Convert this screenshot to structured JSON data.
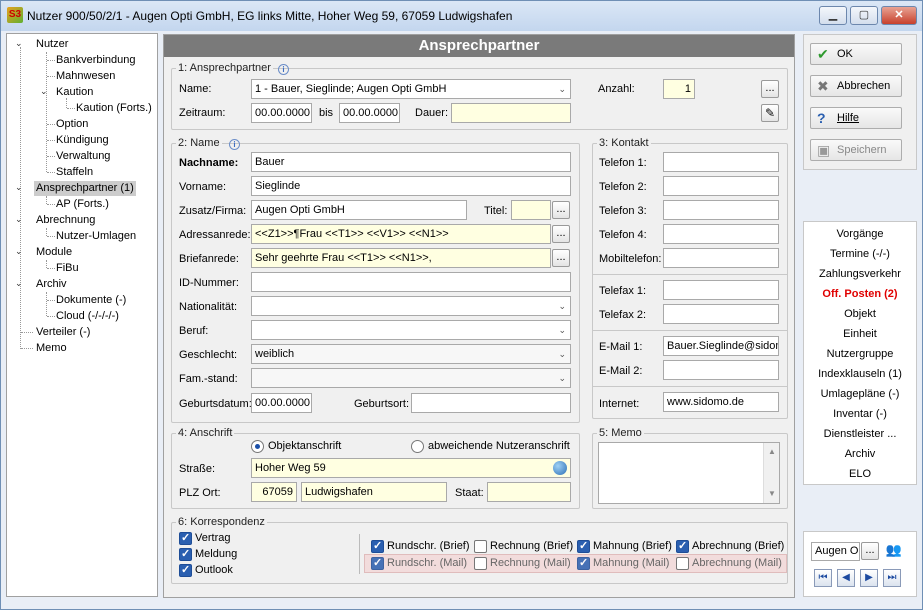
{
  "window": {
    "title": "Nutzer 900/50/2/1 - Augen Opti GmbH, EG links Mitte, Hoher Weg 59, 67059 Ludwigshafen",
    "icon_text": "S3"
  },
  "tree": {
    "items": [
      {
        "label": "Nutzer"
      },
      {
        "label": "Bankverbindung"
      },
      {
        "label": "Mahnwesen"
      },
      {
        "label": "Kaution"
      },
      {
        "label": "Kaution (Forts.)"
      },
      {
        "label": "Option"
      },
      {
        "label": "Kündigung"
      },
      {
        "label": "Verwaltung"
      },
      {
        "label": "Staffeln"
      },
      {
        "label": "Ansprechpartner (1)"
      },
      {
        "label": "AP (Forts.)"
      },
      {
        "label": "Abrechnung"
      },
      {
        "label": "Nutzer-Umlagen"
      },
      {
        "label": "Module"
      },
      {
        "label": "FiBu"
      },
      {
        "label": "Archiv"
      },
      {
        "label": "Dokumente (-)"
      },
      {
        "label": "Cloud (-/-/-/-)"
      },
      {
        "label": "Verteiler (-)"
      },
      {
        "label": "Memo"
      }
    ]
  },
  "header": {
    "title": "Ansprechpartner"
  },
  "section1": {
    "label": "1: Ansprechpartner",
    "name_label": "Name:",
    "name_value": "1 - Bauer, Sieglinde; Augen Opti GmbH",
    "anzahl_label": "Anzahl:",
    "anzahl_value": "1",
    "zeitraum_label": "Zeitraum:",
    "from": "00.00.0000",
    "bis_label": "bis",
    "to": "00.00.0000",
    "dauer_label": "Dauer:",
    "dauer_value": ""
  },
  "section2": {
    "label": "2: Name",
    "fields": {
      "nachname_label": "Nachname:",
      "nachname": "Bauer",
      "vorname_label": "Vorname:",
      "vorname": "Sieglinde",
      "zusatz_label": "Zusatz/Firma:",
      "zusatz": "Augen Opti GmbH",
      "titel_label": "Titel:",
      "titel": "",
      "adressanrede_label": "Adressanrede:",
      "adressanrede": "<<Z1>>¶Frau <<T1>> <<V1>> <<N1>>",
      "briefanrede_label": "Briefanrede:",
      "briefanrede": "Sehr geehrte Frau <<T1>> <<N1>>,",
      "id_label": "ID-Nummer:",
      "id": "",
      "nationalitaet_label": "Nationalität:",
      "nationalitaet": "",
      "beruf_label": "Beruf:",
      "beruf": "",
      "geschlecht_label": "Geschlecht:",
      "geschlecht": "weiblich",
      "famstand_label": "Fam.-stand:",
      "famstand": "",
      "geburtsdatum_label": "Geburtsdatum:",
      "geburtsdatum": "00.00.0000",
      "geburtsort_label": "Geburtsort:",
      "geburtsort": ""
    }
  },
  "section3": {
    "label": "3: Kontakt",
    "telefon1_label": "Telefon 1:",
    "telefon1": "",
    "telefon2_label": "Telefon 2:",
    "telefon2": "",
    "telefon3_label": "Telefon 3:",
    "telefon3": "",
    "telefon4_label": "Telefon 4:",
    "telefon4": "",
    "mobil_label": "Mobiltelefon:",
    "mobil": "",
    "telefax1_label": "Telefax 1:",
    "telefax1": "",
    "telefax2_label": "Telefax 2:",
    "telefax2": "",
    "email1_label": "E-Mail 1:",
    "email1": "Bauer.Sieglinde@sidom",
    "email2_label": "E-Mail 2:",
    "email2": "",
    "internet_label": "Internet:",
    "internet": "www.sidomo.de"
  },
  "section4": {
    "label": "4: Anschrift",
    "radio1": "Objektanschrift",
    "radio2": "abweichende Nutzeranschrift",
    "strasse_label": "Straße:",
    "strasse": "Hoher Weg 59",
    "plzort_label": "PLZ Ort:",
    "plz": "67059",
    "ort": "Ludwigshafen",
    "staat_label": "Staat:",
    "staat": ""
  },
  "section5": {
    "label": "5: Memo"
  },
  "section6": {
    "label": "6: Korrespondenz",
    "left": [
      {
        "label": "Vertrag",
        "checked": true
      },
      {
        "label": "Meldung",
        "checked": true
      },
      {
        "label": "Outlook",
        "checked": true
      }
    ],
    "brief": [
      {
        "label": "Rundschr. (Brief)",
        "checked": true
      },
      {
        "label": "Rechnung (Brief)",
        "checked": false
      },
      {
        "label": "Mahnung (Brief)",
        "checked": true
      },
      {
        "label": "Abrechnung (Brief)",
        "checked": true
      }
    ],
    "mail": [
      {
        "label": "Rundschr. (Mail)",
        "checked": true
      },
      {
        "label": "Rechnung (Mail)",
        "checked": false
      },
      {
        "label": "Mahnung (Mail)",
        "checked": true
      },
      {
        "label": "Abrechnung (Mail)",
        "checked": false
      }
    ]
  },
  "actions": {
    "ok": "OK",
    "cancel": "Abbrechen",
    "help": "Hilfe",
    "save": "Speichern"
  },
  "sidenav": [
    {
      "label": "Vorgänge"
    },
    {
      "label": "Termine (-/-)"
    },
    {
      "label": "Zahlungsverkehr"
    },
    {
      "label": "Off. Posten (2)",
      "highlight": true
    },
    {
      "label": "Objekt"
    },
    {
      "label": "Einheit"
    },
    {
      "label": "Nutzergruppe"
    },
    {
      "label": "Indexklauseln (1)"
    },
    {
      "label": "Umlagepläne (-)"
    },
    {
      "label": "Inventar (-)"
    },
    {
      "label": "Dienstleister ..."
    },
    {
      "label": "Archiv"
    },
    {
      "label": "ELO"
    }
  ],
  "navbox": {
    "search_value": "Augen O",
    "dots": "..."
  },
  "colors": {
    "header_bg": "#7a7a7a",
    "field_yellow": "#ffffe1",
    "mail_row_bg": "#f2dcdc",
    "highlight_red": "#e00000",
    "check_blue": "#2a5fb0"
  }
}
